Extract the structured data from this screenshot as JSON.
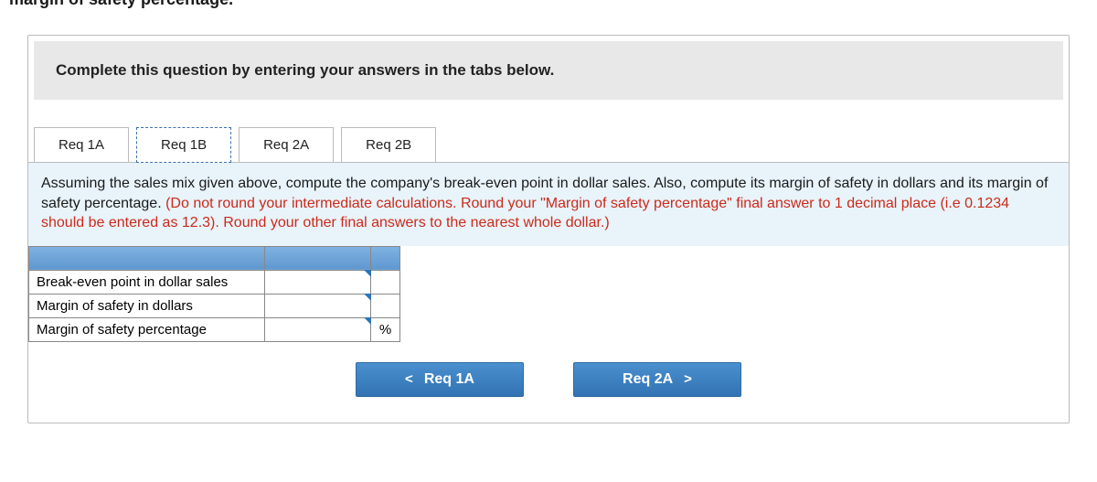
{
  "cut_text": "margin of safety percentage.",
  "instruction": "Complete this question by entering your answers in the tabs below.",
  "tabs": [
    {
      "label": "Req 1A"
    },
    {
      "label": "Req 1B"
    },
    {
      "label": "Req 2A"
    },
    {
      "label": "Req 2B"
    }
  ],
  "active_tab_index": 1,
  "prompt": {
    "black1": "Assuming the sales mix given above, compute the company's break-even point in dollar sales. Also, compute its margin of safety in dollars and its margin of safety percentage. ",
    "red1": "(Do not round your intermediate calculations. ",
    "purple1": " ",
    "red2": "Round your \"Margin of safety percentage\" final answer to 1 decimal place (i.e 0.1234 should be entered as 12.3). ",
    "purple2": " ",
    "red3": "Round your other final answers to the nearest whole dollar.)"
  },
  "rows": [
    {
      "label": "Break-even point in dollar sales",
      "value": "",
      "unit": ""
    },
    {
      "label": "Margin of safety in dollars",
      "value": "",
      "unit": ""
    },
    {
      "label": "Margin of safety percentage",
      "value": "",
      "unit": "%"
    }
  ],
  "nav": {
    "prev_chevron": "<",
    "prev_label": "Req 1A",
    "next_label": "Req 2A",
    "next_chevron": ">"
  }
}
